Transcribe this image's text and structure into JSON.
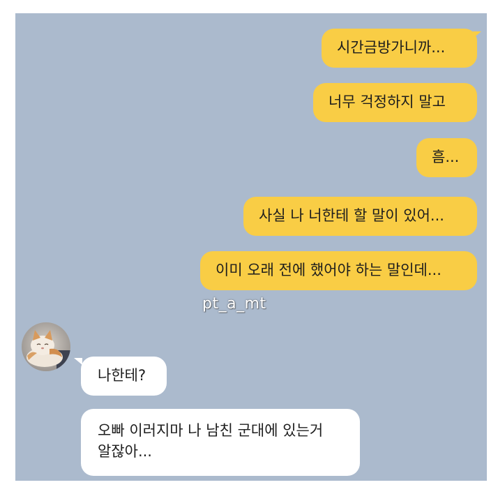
{
  "messages_sent": [
    {
      "text": "시간금방가니까..."
    },
    {
      "text": "너무 걱정하지 말고"
    },
    {
      "text": "흠..."
    },
    {
      "text": "사실 나 너한테 할 말이 있어..."
    },
    {
      "text": "이미 오래 전에 했어야 하는 말인데..."
    }
  ],
  "watermark": "pt_a_mt",
  "messages_received": [
    {
      "lines": [
        "나한테?"
      ]
    },
    {
      "lines": [
        "오빠 이러지마 나 남친 군대에 있는거",
        "알잖아..."
      ]
    }
  ],
  "colors": {
    "chat_background": "#abbacd",
    "sent_bubble": "#f9cd45",
    "received_bubble": "#ffffff"
  },
  "avatar_icon": "cat-icon"
}
